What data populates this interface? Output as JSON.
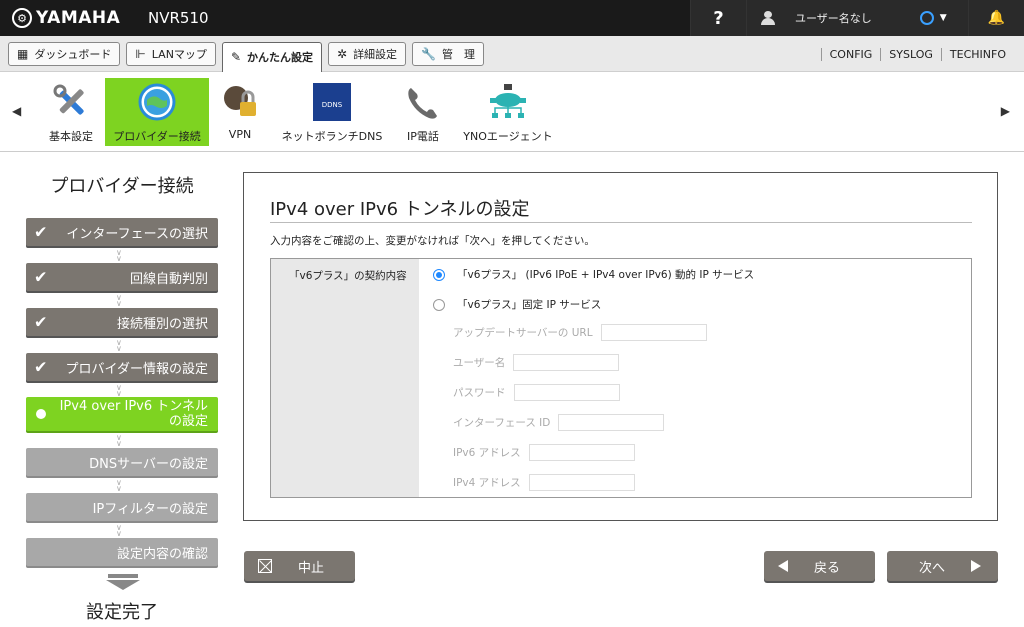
{
  "topbar": {
    "brand": "YAMAHA",
    "model": "NVR510",
    "help": "?",
    "user_name": "ユーザー名なし"
  },
  "mainnav": {
    "items": [
      {
        "label": "ダッシュボード",
        "icon": "dashboard-icon"
      },
      {
        "label": "LANマップ",
        "icon": "lanmap-icon"
      },
      {
        "label": "かんたん設定",
        "icon": "wizard-icon"
      },
      {
        "label": "詳細設定",
        "icon": "gear-icon"
      },
      {
        "label": "管　理",
        "icon": "wrench-icon"
      }
    ],
    "links": [
      "CONFIG",
      "SYSLOG",
      "TECHINFO"
    ]
  },
  "toolbar": {
    "items": [
      {
        "label": "基本設定",
        "icon": "tools-icon"
      },
      {
        "label": "プロバイダー接続",
        "icon": "globe-icon"
      },
      {
        "label": "VPN",
        "icon": "vpn-icon"
      },
      {
        "label": "ネットボランチDNS",
        "icon": "ddns-icon",
        "badge": "DDNS Service"
      },
      {
        "label": "IP電話",
        "icon": "phone-icon"
      },
      {
        "label": "YNOエージェント",
        "icon": "network-icon"
      }
    ]
  },
  "steps": {
    "title": "プロバイダー接続",
    "items": [
      {
        "label": "インターフェースの選択",
        "state": "done"
      },
      {
        "label": "回線自動判別",
        "state": "done"
      },
      {
        "label": "接続種別の選択",
        "state": "done"
      },
      {
        "label": "プロバイダー情報の設定",
        "state": "done"
      },
      {
        "label_line1": "IPv4 over IPv6 トンネル",
        "label_line2": "の設定",
        "state": "current"
      },
      {
        "label": "DNSサーバーの設定",
        "state": "pending"
      },
      {
        "label": "IPフィルターの設定",
        "state": "pending"
      },
      {
        "label": "設定内容の確認",
        "state": "pending"
      }
    ],
    "done_label": "設定完了"
  },
  "panel": {
    "title": "IPv4 over IPv6 トンネルの設定",
    "description": "入力内容をご確認の上、変更がなければ「次へ」を押してください。",
    "contract_label": "「v6プラス」の契約内容",
    "option_dynamic": "「v6プラス」 (IPv6 IPoE + IPv4 over IPv6) 動的 IP サービス",
    "option_fixed": "「v6プラス」固定 IP サービス",
    "fields": {
      "update_server_url": "アップデートサーバーの URL",
      "username": "ユーザー名",
      "password": "パスワード",
      "interface_id": "インターフェース ID",
      "ipv6_address": "IPv6 アドレス",
      "ipv4_address": "IPv4 アドレス"
    }
  },
  "buttons": {
    "cancel": "中止",
    "back": "戻る",
    "next": "次へ"
  }
}
